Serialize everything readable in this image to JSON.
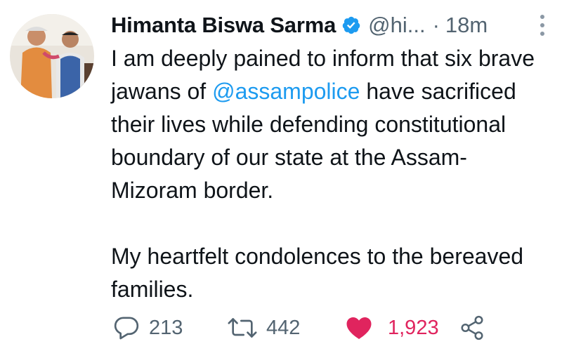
{
  "author": {
    "name": "Himanta Biswa Sarma",
    "handle": "@hi...",
    "separator": "·",
    "time": "18m"
  },
  "tweet": {
    "para1_before": "I am deeply pained to inform that six brave jawans of ",
    "mention": "@assampolice",
    "para1_after": " have sacrificed their lives while defending constitutional boundary of our state at the Assam-Mizoram border.",
    "para2": "My heartfelt condolences to the bereaved families."
  },
  "actions": {
    "replies": "213",
    "retweets": "442",
    "likes": "1,923"
  },
  "icons": {
    "verified": "verified-badge-icon",
    "more": "more-vertical-icon",
    "reply": "reply-icon",
    "retweet": "retweet-icon",
    "like": "heart-filled-icon",
    "share": "share-icon"
  },
  "colors": {
    "text": "#0f1419",
    "secondary": "#536471",
    "link": "#1d9bf0",
    "like": "#e0245e"
  }
}
